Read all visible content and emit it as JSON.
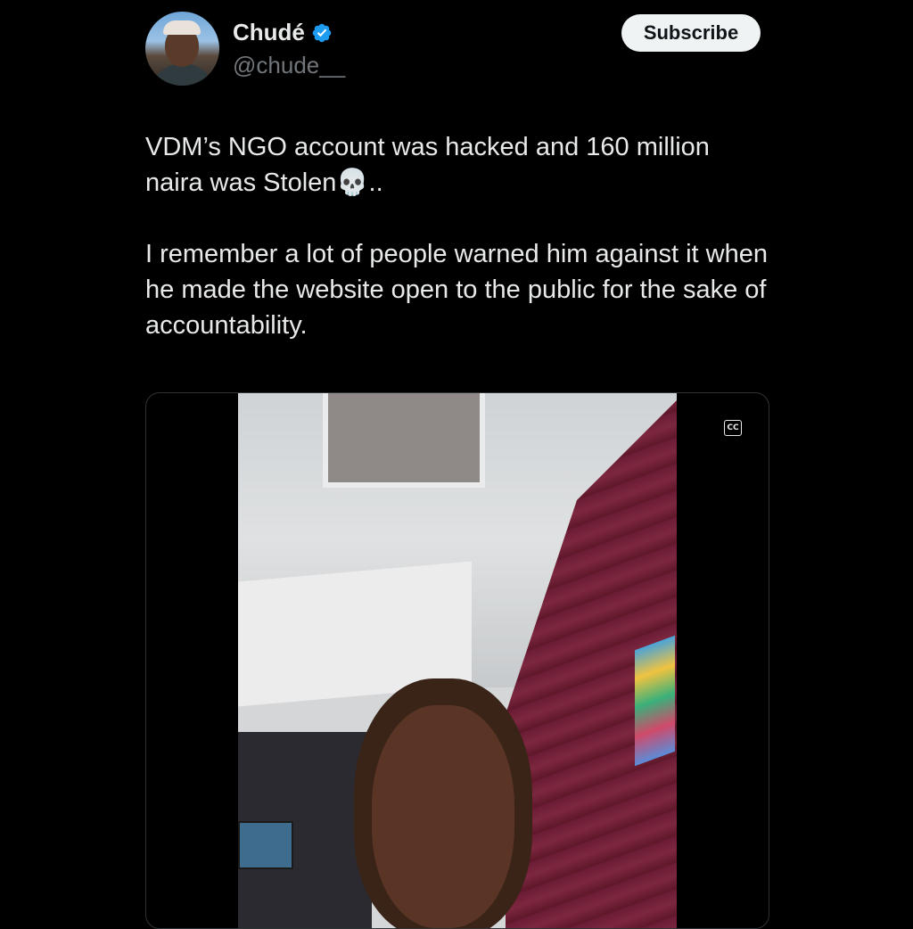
{
  "author": {
    "name": "Chudé",
    "handle": "@chude__",
    "verified": true
  },
  "subscribe_label": "Subscribe",
  "tweet": {
    "paragraph1": "VDM’s NGO account was hacked and 160 million naira was Stolen💀..",
    "paragraph2": "I remember a lot of people warned him against it when he made the website open to the public for the sake of accountability."
  },
  "media": {
    "captions_icon": "cc-icon",
    "captions_label": "CC"
  },
  "colors": {
    "background": "#000000",
    "text": "#e7e9ea",
    "secondary_text": "#71767b",
    "verified_badge": "#1d9bf0",
    "subscribe_bg": "#eff3f4"
  }
}
